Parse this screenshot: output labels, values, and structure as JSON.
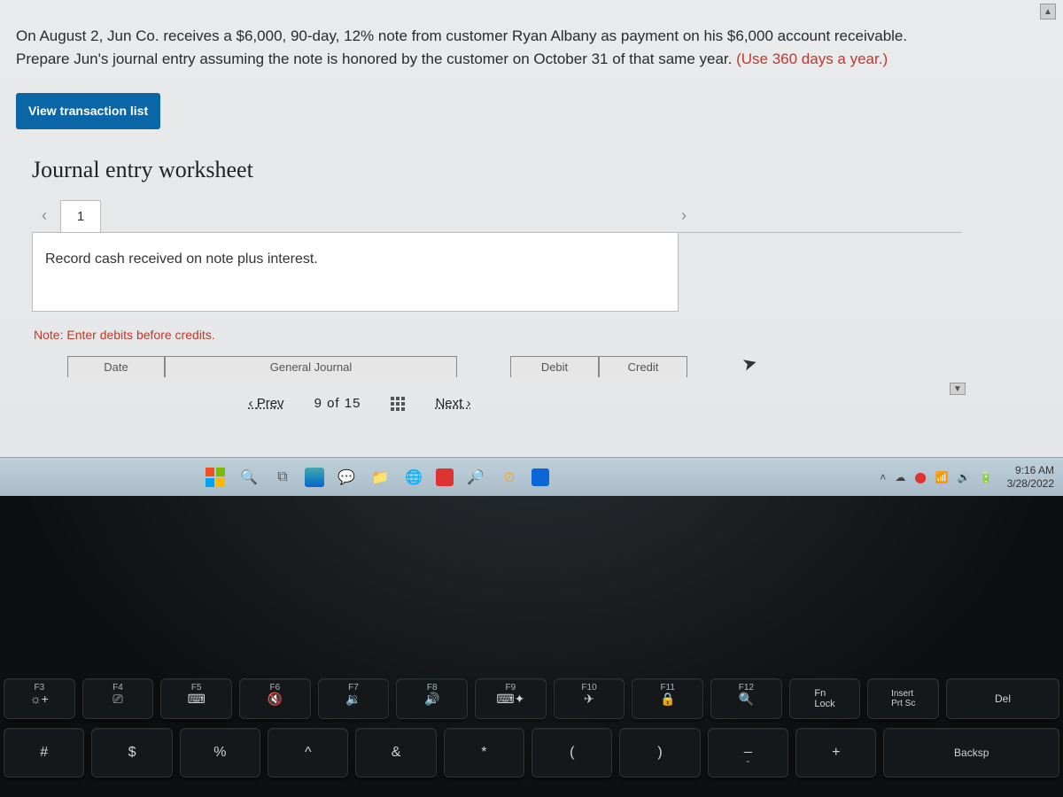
{
  "problem": {
    "line1_a": "On August 2, Jun Co. receives a $6,000, 90-day, 12% note from customer Ryan Albany as payment on his $6,000 account receivable.",
    "line2_a": "Prepare Jun's journal entry assuming the note is honored by the customer on October 31 of that same year. ",
    "line2_red": "(Use 360 days a year.)"
  },
  "buttons": {
    "view_transaction_list": "View transaction list"
  },
  "worksheet": {
    "title": "Journal entry worksheet",
    "page_number": "1",
    "instruction": "Record cash received on note plus interest.",
    "note": "Note: Enter debits before credits.",
    "headers": {
      "date": "Date",
      "gj": "General Journal",
      "debit": "Debit",
      "credit": "Credit"
    }
  },
  "nav": {
    "prev": "Prev",
    "count": "9 of 15",
    "next": "Next"
  },
  "taskbar": {
    "time": "9:16 AM",
    "date": "3/28/2022"
  },
  "keys_fn": [
    {
      "label": "F3",
      "icon": "☼+"
    },
    {
      "label": "F4",
      "icon": "⎚"
    },
    {
      "label": "F5",
      "icon": "⌨"
    },
    {
      "label": "F6",
      "icon": "🔇"
    },
    {
      "label": "F7",
      "icon": "🔉"
    },
    {
      "label": "F8",
      "icon": "🔊"
    },
    {
      "label": "F9",
      "icon": "⌨✦"
    },
    {
      "label": "F10",
      "icon": "✈"
    },
    {
      "label": "F11",
      "icon": "🔒"
    },
    {
      "label": "F12",
      "icon": "🔍"
    },
    {
      "label": "Fn Lock",
      "icon": ""
    },
    {
      "label": "Insert Prt Sc",
      "icon": ""
    },
    {
      "label": "Del",
      "icon": ""
    }
  ],
  "keys_num": [
    {
      "top": "#",
      "bot": ""
    },
    {
      "top": "$",
      "bot": ""
    },
    {
      "top": "%",
      "bot": ""
    },
    {
      "top": "^",
      "bot": ""
    },
    {
      "top": "&",
      "bot": ""
    },
    {
      "top": "*",
      "bot": ""
    },
    {
      "top": "(",
      "bot": ""
    },
    {
      "top": ")",
      "bot": ""
    },
    {
      "top": "_",
      "bot": "-"
    },
    {
      "top": "+",
      "bot": ""
    },
    {
      "top": "Backsp",
      "bot": ""
    }
  ]
}
